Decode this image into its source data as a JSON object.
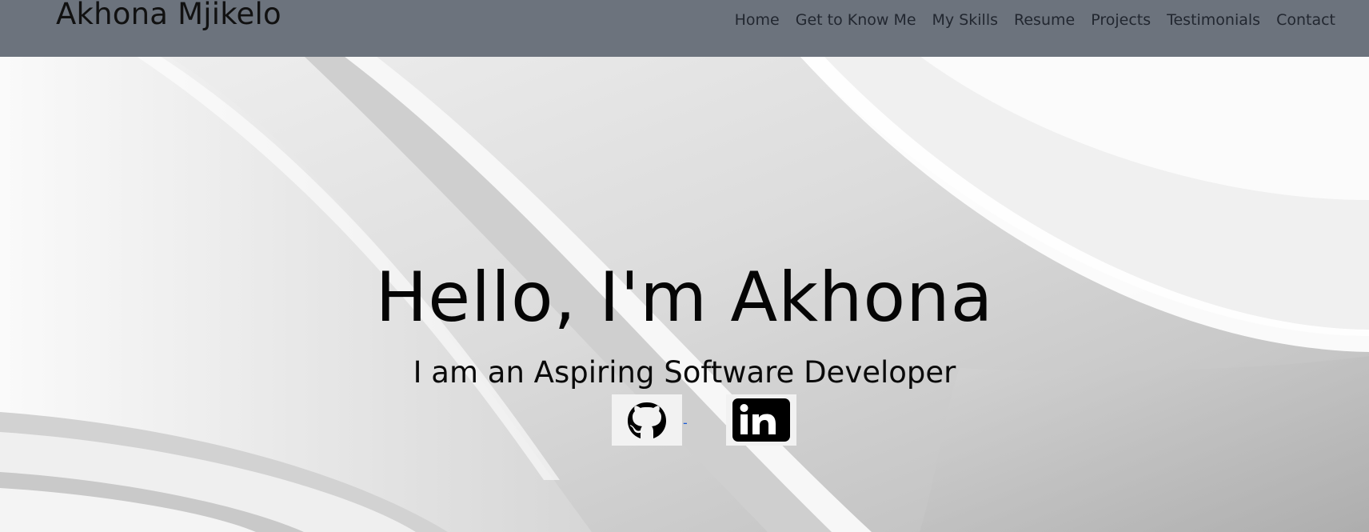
{
  "brand": "Akhona Mjikelo",
  "nav": {
    "items": [
      {
        "label": "Home"
      },
      {
        "label": "Get to Know Me"
      },
      {
        "label": "My Skills"
      },
      {
        "label": "Resume"
      },
      {
        "label": "Projects"
      },
      {
        "label": "Testimonials"
      },
      {
        "label": "Contact"
      }
    ]
  },
  "hero": {
    "title": "Hello, I'm Akhona",
    "subtitle": "I am an Aspiring Software Developer",
    "separator": "-"
  },
  "socials": {
    "github_icon": "github-icon",
    "linkedin_icon": "linkedin-icon"
  },
  "colors": {
    "navbar": "#6c737d",
    "background": "#e6e6e7",
    "text": "#050505"
  }
}
